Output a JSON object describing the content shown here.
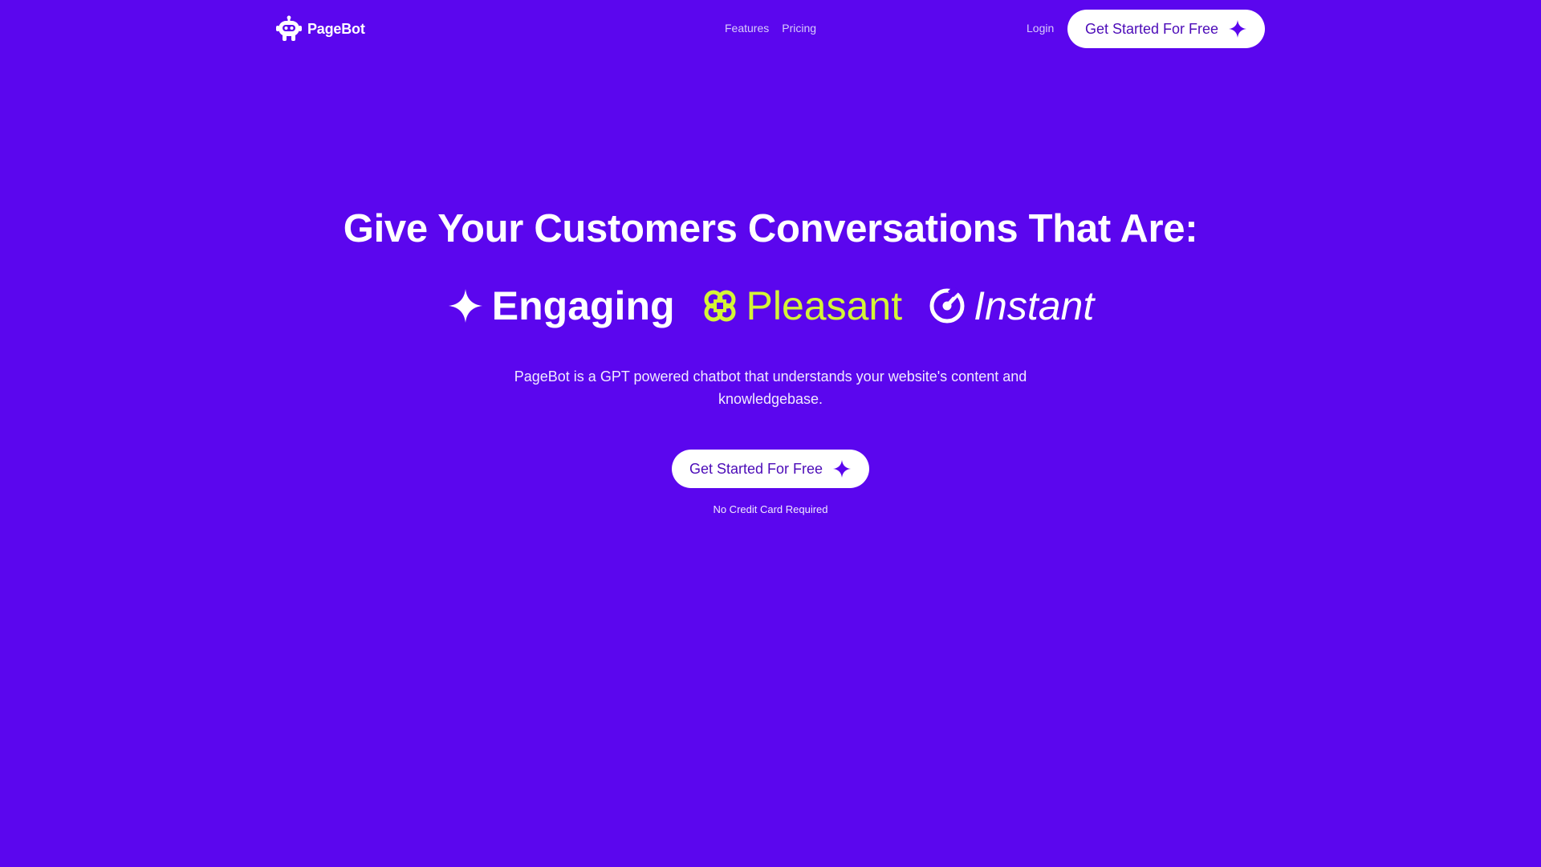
{
  "nav": {
    "brand": "PageBot",
    "links": [
      {
        "label": "Features"
      },
      {
        "label": "Pricing"
      }
    ],
    "login": "Login",
    "cta_label": "Get Started For Free",
    "logo_icon": "robot-head-icon",
    "cta_icon": "sparkle-star-icon"
  },
  "hero": {
    "title": "Give Your Customers Conversations That Are:",
    "features": [
      {
        "label": "Engaging",
        "icon": "sparkle-star-icon",
        "color": "#ffffff"
      },
      {
        "label": "Pleasant",
        "icon": "command-knot-icon",
        "color": "#d4f536"
      },
      {
        "label": "Instant",
        "icon": "timer-gauge-icon",
        "color": "#ffffff"
      }
    ],
    "description": "PageBot is a GPT powered chatbot that understands your website's content and knowledgebase.",
    "cta_label": "Get Started For Free",
    "note": "No Credit Card Required"
  },
  "colors": {
    "background": "#5b06ee",
    "accent": "#d4f536",
    "button_text": "#4c0bb8",
    "button_bg": "#ffffff"
  }
}
